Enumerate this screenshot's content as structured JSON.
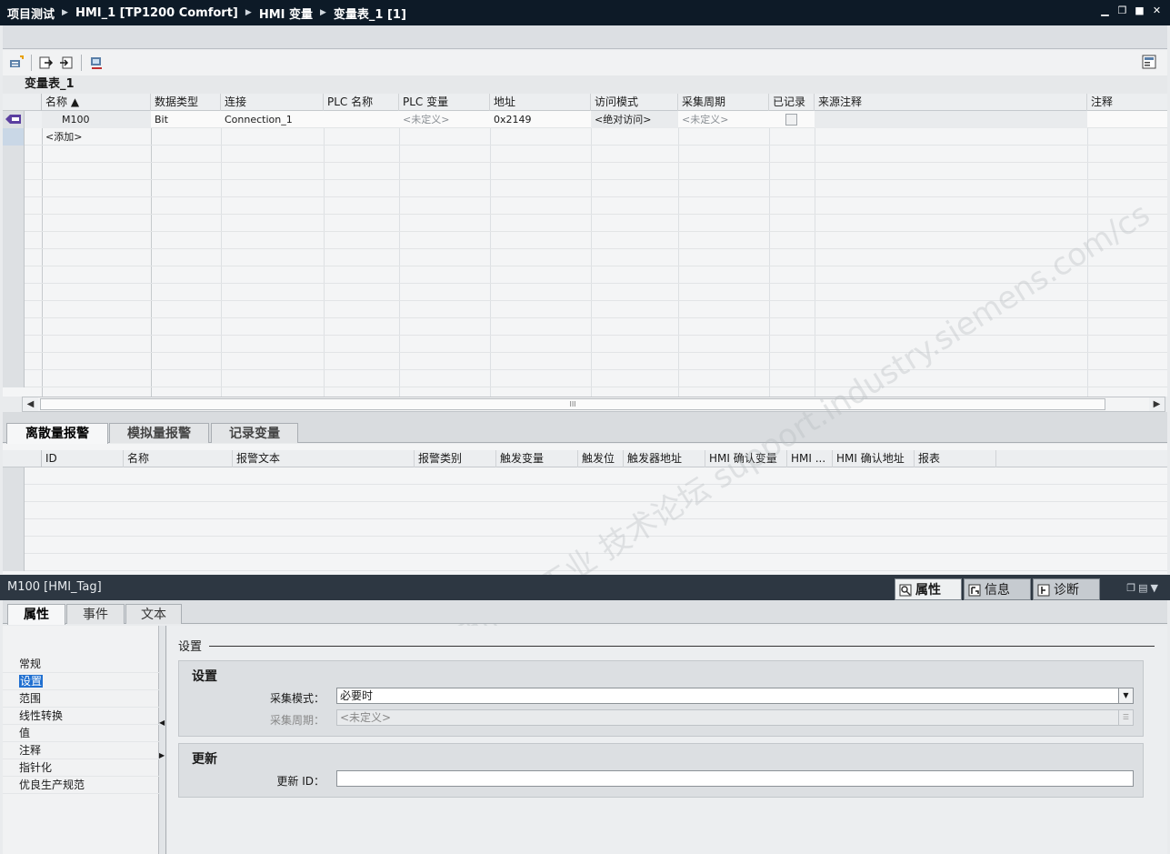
{
  "titlebar": {
    "crumbs": [
      "项目测试",
      "HMI_1 [TP1200 Comfort]",
      "HMI 变量",
      "变量表_1 [1]"
    ],
    "controls": [
      "-",
      "▭",
      "■",
      "✕"
    ]
  },
  "table_title": "变量表_1",
  "tag_table": {
    "columns": [
      "名称 ▲",
      "数据类型",
      "连接",
      "PLC 名称",
      "PLC 变量",
      "地址",
      "访问模式",
      "采集周期",
      "已记录",
      "来源注释",
      "注释"
    ],
    "rows": [
      {
        "name": "M100",
        "datatype": "Bit",
        "connection": "Connection_1",
        "plc_name": "",
        "plc_tag": "<未定义>",
        "address": "0x2149",
        "access": "<绝对访问>",
        "cycle": "<未定义>",
        "logged": false,
        "source_comment": "",
        "comment": ""
      }
    ],
    "add_label": "<添加>"
  },
  "hscroll_grip": "III",
  "alarm_tabs": [
    "离散量报警",
    "模拟量报警",
    "记录变量"
  ],
  "alarm_columns": [
    "ID",
    "名称",
    "报警文本",
    "报警类别",
    "触发变量",
    "触发位",
    "触发器地址",
    "HMI 确认变量",
    "HMI ...",
    "HMI 确认地址",
    "报表"
  ],
  "inspector": {
    "object": "M100 [HMI_Tag]",
    "tabs": [
      "属性",
      "信息",
      "诊断"
    ]
  },
  "prop_tabs": [
    "属性",
    "事件",
    "文本"
  ],
  "nav_items": [
    "常规",
    "设置",
    "范围",
    "线性转换",
    "值",
    "注释",
    "指针化",
    "优良生产规范"
  ],
  "content": {
    "section": "设置",
    "group1_title": "设置",
    "acq_mode_label": "采集模式：",
    "acq_mode_value": "必要时",
    "acq_cycle_label": "采集周期：",
    "acq_cycle_value": "<未定义>",
    "group2_title": "更新",
    "update_id_label": "更新 ID：",
    "update_id_value": ""
  },
  "watermark": "西门子工业 技术论坛 support.industry.siemens.com/cs",
  "colors": {
    "titlebar": "#0d1a27",
    "inspector_bar": "#2d3742",
    "selection": "#1f6fd0"
  }
}
